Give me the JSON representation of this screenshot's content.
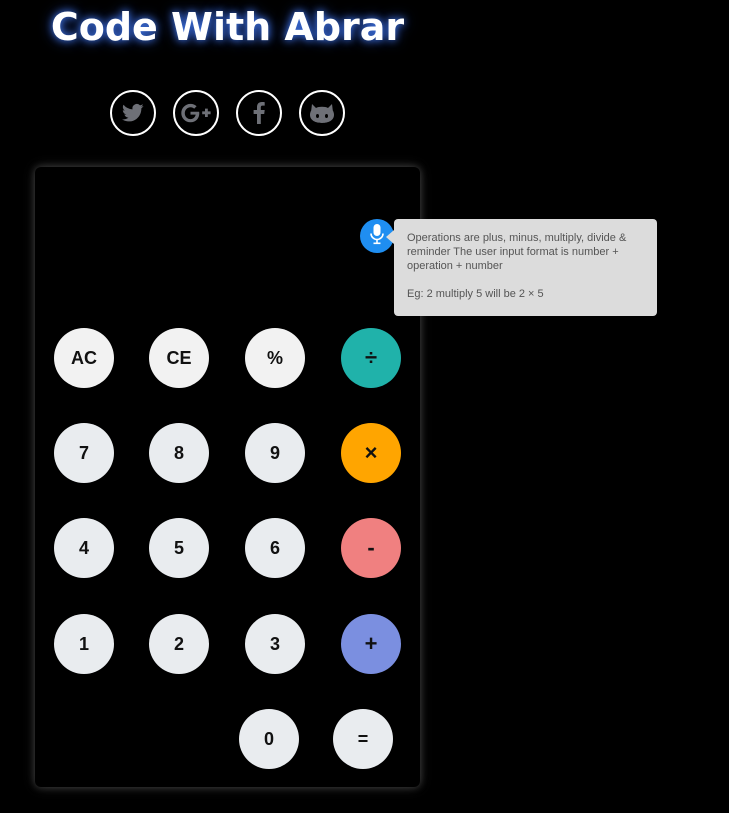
{
  "header": {
    "title": "Code With Abrar"
  },
  "social": [
    {
      "icon": "twitter-icon"
    },
    {
      "icon": "google-plus-icon"
    },
    {
      "icon": "facebook-icon"
    },
    {
      "icon": "github-icon"
    }
  ],
  "voice": {
    "icon": "microphone-icon",
    "accent_color": "#1f8ef1",
    "tooltip_line1": "Operations are plus, minus, multiply, divide & reminder The user input format is number + operation + number",
    "tooltip_line2": "Eg: 2 multiply 5 will be 2 × 5"
  },
  "display": {
    "value": ""
  },
  "buttons": {
    "ac": "AC",
    "ce": "CE",
    "percent": "%",
    "divide": "÷",
    "seven": "7",
    "eight": "8",
    "nine": "9",
    "multiply": "×",
    "four": "4",
    "five": "5",
    "six": "6",
    "minus": "-",
    "one": "1",
    "two": "2",
    "three": "3",
    "plus": "+",
    "zero": "0",
    "equals": "="
  },
  "colors": {
    "divide": "#20b2aa",
    "multiply": "#ffa500",
    "minus": "#f08080",
    "plus": "#7b8fe0",
    "number": "#e9ecef",
    "background": "#000000"
  }
}
